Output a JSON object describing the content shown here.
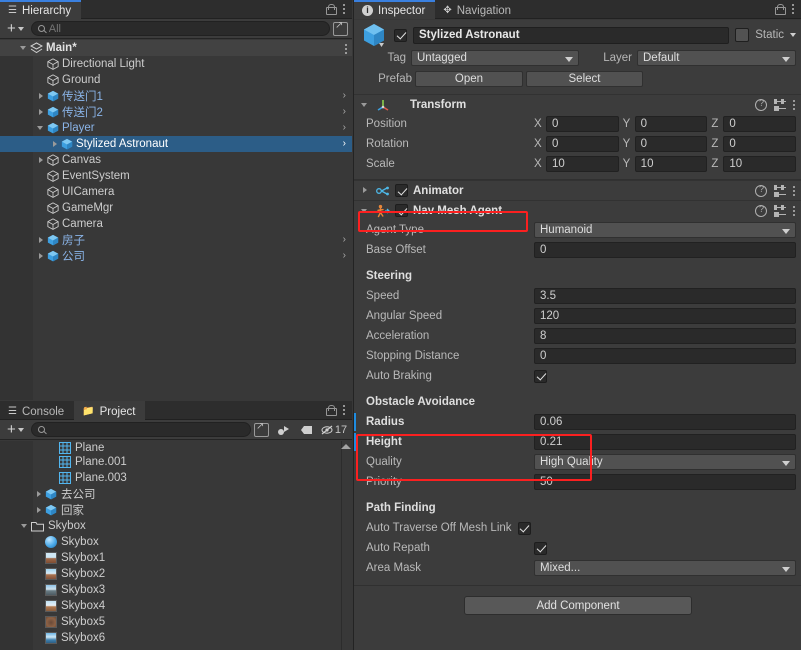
{
  "hierarchy": {
    "tab": "Hierarchy",
    "search_placeholder": "All",
    "scene": {
      "name": "Main*"
    },
    "items": [
      {
        "label": "Directional Light",
        "indent": 2,
        "arrow": "none",
        "blue": false,
        "cube": "plain",
        "right": false
      },
      {
        "label": "Ground",
        "indent": 2,
        "arrow": "none",
        "blue": false,
        "cube": "plain",
        "right": false
      },
      {
        "label": "传送门1",
        "indent": 2,
        "arrow": "closed",
        "blue": true,
        "cube": "prefab",
        "right": true
      },
      {
        "label": "传送门2",
        "indent": 2,
        "arrow": "closed",
        "blue": true,
        "cube": "prefab",
        "right": true
      },
      {
        "label": "Player",
        "indent": 2,
        "arrow": "open",
        "blue": true,
        "cube": "prefab",
        "right": true
      },
      {
        "label": "Stylized Astronaut",
        "indent": 3,
        "arrow": "closed",
        "blue": true,
        "cube": "prefab",
        "right": true,
        "selected": true
      },
      {
        "label": "Canvas",
        "indent": 2,
        "arrow": "closed",
        "blue": false,
        "cube": "plain",
        "right": false
      },
      {
        "label": "EventSystem",
        "indent": 2,
        "arrow": "none",
        "blue": false,
        "cube": "plain",
        "right": false
      },
      {
        "label": "UICamera",
        "indent": 2,
        "arrow": "none",
        "blue": false,
        "cube": "plain",
        "right": false
      },
      {
        "label": "GameMgr",
        "indent": 2,
        "arrow": "none",
        "blue": false,
        "cube": "plain",
        "right": false
      },
      {
        "label": "Camera",
        "indent": 2,
        "arrow": "none",
        "blue": false,
        "cube": "plain",
        "right": false
      },
      {
        "label": "房子",
        "indent": 2,
        "arrow": "closed",
        "blue": true,
        "cube": "prefab",
        "right": true
      },
      {
        "label": "公司",
        "indent": 2,
        "arrow": "closed",
        "blue": true,
        "cube": "prefab",
        "right": true
      }
    ]
  },
  "project": {
    "tabs": [
      {
        "label": "Console",
        "active": false,
        "icon": "console-icon"
      },
      {
        "label": "Project",
        "active": true,
        "icon": "folder-icon"
      }
    ],
    "search_placeholder": "",
    "hidden_count": "17",
    "items": [
      {
        "label": "Plane",
        "indent": 3,
        "arrow": "none",
        "icon": "mesh",
        "clipped": true
      },
      {
        "label": "Plane.001",
        "indent": 3,
        "arrow": "none",
        "icon": "mesh"
      },
      {
        "label": "Plane.003",
        "indent": 3,
        "arrow": "none",
        "icon": "mesh"
      },
      {
        "label": "去公司",
        "indent": 2,
        "arrow": "closed",
        "icon": "prefab"
      },
      {
        "label": "回家",
        "indent": 2,
        "arrow": "closed",
        "icon": "prefab"
      },
      {
        "label": "Skybox",
        "indent": 1,
        "arrow": "open",
        "icon": "folder"
      },
      {
        "label": "Skybox",
        "indent": 2,
        "arrow": "none",
        "icon": "material"
      },
      {
        "label": "Skybox1",
        "indent": 2,
        "arrow": "none",
        "icon": "tex1"
      },
      {
        "label": "Skybox2",
        "indent": 2,
        "arrow": "none",
        "icon": "tex2"
      },
      {
        "label": "Skybox3",
        "indent": 2,
        "arrow": "none",
        "icon": "tex3"
      },
      {
        "label": "Skybox4",
        "indent": 2,
        "arrow": "none",
        "icon": "tex4"
      },
      {
        "label": "Skybox5",
        "indent": 2,
        "arrow": "none",
        "icon": "tex5"
      },
      {
        "label": "Skybox6",
        "indent": 2,
        "arrow": "none",
        "icon": "tex6"
      }
    ]
  },
  "inspector": {
    "tabs": [
      {
        "label": "Inspector",
        "active": true
      },
      {
        "label": "Navigation",
        "active": false
      }
    ],
    "gameobject": {
      "enabled": true,
      "name": "Stylized Astronaut",
      "static_label": "Static",
      "static_checked": false,
      "tag_label": "Tag",
      "tag_value": "Untagged",
      "layer_label": "Layer",
      "layer_value": "Default",
      "prefab_label": "Prefab",
      "prefab_open": "Open",
      "prefab_select": "Select"
    },
    "transform": {
      "title": "Transform",
      "rows": [
        {
          "label": "Position",
          "x": "0",
          "y": "0",
          "z": "0"
        },
        {
          "label": "Rotation",
          "x": "0",
          "y": "0",
          "z": "0"
        },
        {
          "label": "Scale",
          "x": "10",
          "y": "10",
          "z": "10"
        }
      ],
      "axis_labels": [
        "X",
        "Y",
        "Z"
      ]
    },
    "animator": {
      "title": "Animator",
      "enabled": true,
      "expanded": false
    },
    "navmesh": {
      "title": "Nav Mesh Agent",
      "enabled": true,
      "expanded": true,
      "highlighted": true,
      "agent_type_label": "Agent Type",
      "agent_type_value": "Humanoid",
      "base_offset_label": "Base Offset",
      "base_offset_value": "0",
      "steering_header": "Steering",
      "speed_label": "Speed",
      "speed_value": "3.5",
      "angular_speed_label": "Angular Speed",
      "angular_speed_value": "120",
      "acceleration_label": "Acceleration",
      "acceleration_value": "8",
      "stopping_distance_label": "Stopping Distance",
      "stopping_distance_value": "0",
      "auto_braking_label": "Auto Braking",
      "auto_braking_checked": true,
      "obstacle_header": "Obstacle Avoidance",
      "radius_label": "Radius",
      "radius_value": "0.06",
      "height_label": "Height",
      "height_value": "0.21",
      "quality_label": "Quality",
      "quality_value": "High Quality",
      "priority_label": "Priority",
      "priority_value": "50",
      "pathfinding_header": "Path Finding",
      "auto_traverse_label": "Auto Traverse Off Mesh Link",
      "auto_traverse_checked": true,
      "auto_repath_label": "Auto Repath",
      "auto_repath_checked": true,
      "area_mask_label": "Area Mask",
      "area_mask_value": "Mixed..."
    },
    "add_component": "Add Component"
  },
  "colors": {
    "selection_blue": "#2c5d87",
    "highlight_red": "#fb2020",
    "override_blue": "#1f8ce0",
    "prefab_blue": "#8ab4e8",
    "panel_bg": "#383838",
    "inspector_bg": "#3c3c3c"
  }
}
